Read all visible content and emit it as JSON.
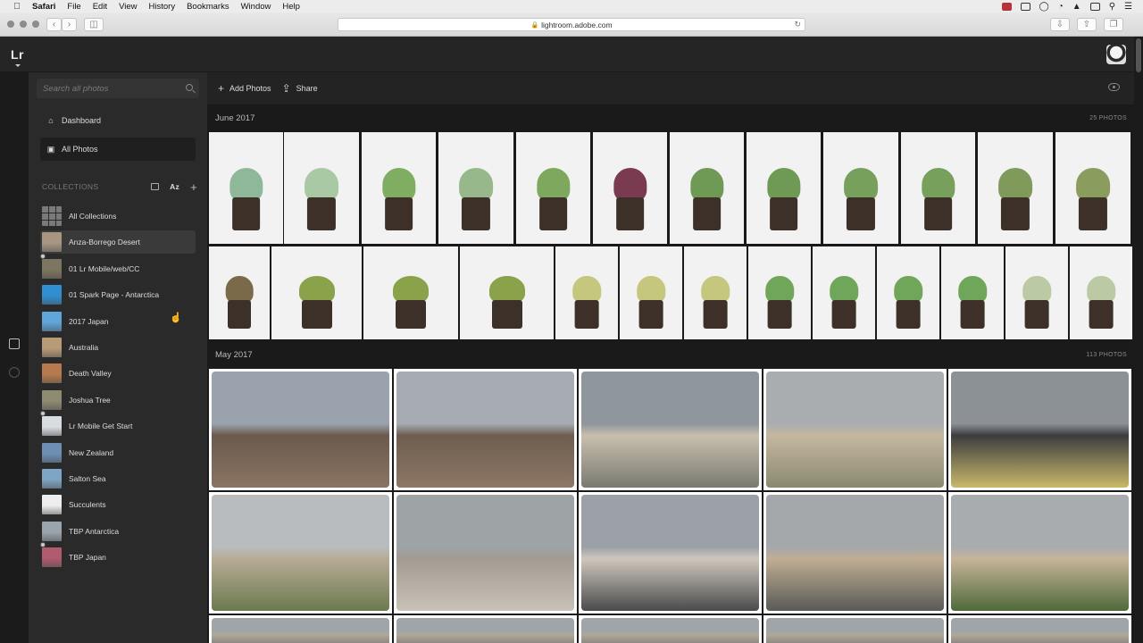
{
  "menubar": {
    "app": "Safari",
    "items": [
      "File",
      "Edit",
      "View",
      "History",
      "Bookmarks",
      "Window",
      "Help"
    ]
  },
  "browser": {
    "url": "lightroom.adobe.com"
  },
  "app": {
    "logo": "Lr"
  },
  "sidebar": {
    "search_placeholder": "Search all photos",
    "nav": [
      {
        "label": "Dashboard",
        "icon": "home-icon"
      },
      {
        "label": "All Photos",
        "icon": "photo-icon",
        "active": true
      }
    ],
    "collections_header": "COLLECTIONS",
    "sort_label": "Az",
    "collections": [
      {
        "label": "All Collections",
        "color": "#6a6a6a"
      },
      {
        "label": "Anza-Borrego Desert",
        "color": "#a89682",
        "hover": true
      },
      {
        "label": "01 Lr Mobile/web/CC",
        "color": "#7c7560"
      },
      {
        "label": "01 Spark Page - Antarctica",
        "color": "#2f8fd0"
      },
      {
        "label": "2017 Japan",
        "color": "#5fa5d8"
      },
      {
        "label": "Australia",
        "color": "#b89a76"
      },
      {
        "label": "Death Valley",
        "color": "#b67a4e"
      },
      {
        "label": "Joshua Tree",
        "color": "#8f8a72"
      },
      {
        "label": "Lr Mobile Get Start",
        "color": "#d9dce0"
      },
      {
        "label": "New Zealand",
        "color": "#6d8fb4"
      },
      {
        "label": "Salton Sea",
        "color": "#7ea6c4"
      },
      {
        "label": "Succulents",
        "color": "#eeeeee"
      },
      {
        "label": "TBP Antarctica",
        "color": "#9aa4ad"
      },
      {
        "label": "TBP Japan",
        "color": "#b05b6e"
      }
    ]
  },
  "toolbar": {
    "add_photos": "Add Photos",
    "share": "Share"
  },
  "sections": [
    {
      "date": "June 2017",
      "count": "25 PHOTOS"
    },
    {
      "date": "May 2017",
      "count": "113 PHOTOS"
    }
  ]
}
